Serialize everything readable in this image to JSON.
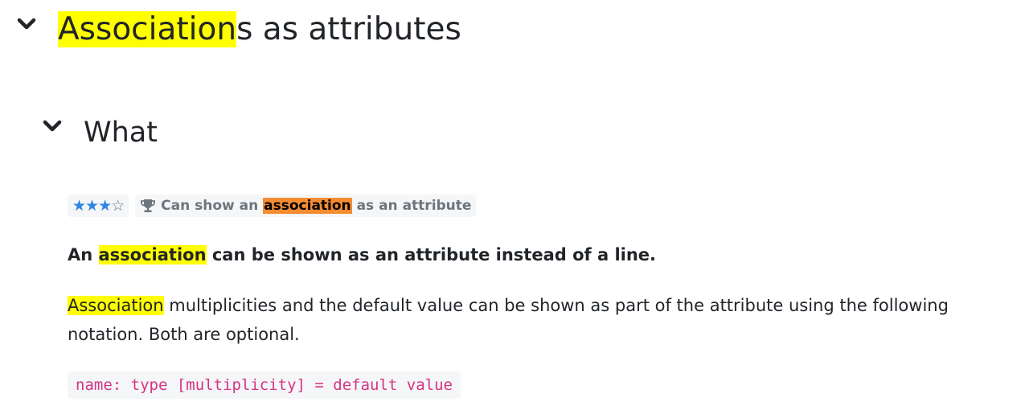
{
  "section": {
    "title_highlight": "Association",
    "title_rest": "s as attributes"
  },
  "subsection": {
    "title": "What"
  },
  "badges": {
    "rating_filled": "★★★",
    "rating_empty": "☆",
    "rating_value": 3,
    "rating_max": 4,
    "goal_prefix": "Can show an",
    "goal_highlight": "association",
    "goal_suffix": "as an attribute"
  },
  "lead": {
    "prefix": "An",
    "highlight": "association",
    "suffix": "can be shown as an attribute instead of a line."
  },
  "paragraph": {
    "highlight": "Association",
    "text": " multiplicities and the default value can be shown as part of the attribute using the following notation. Both are optional."
  },
  "code": {
    "text": "name: type [multiplicity] = default value"
  },
  "colors": {
    "highlight": "#ffff00",
    "highlight_orange": "#f48c32",
    "star": "#2f86e4",
    "code": "#d63384"
  }
}
